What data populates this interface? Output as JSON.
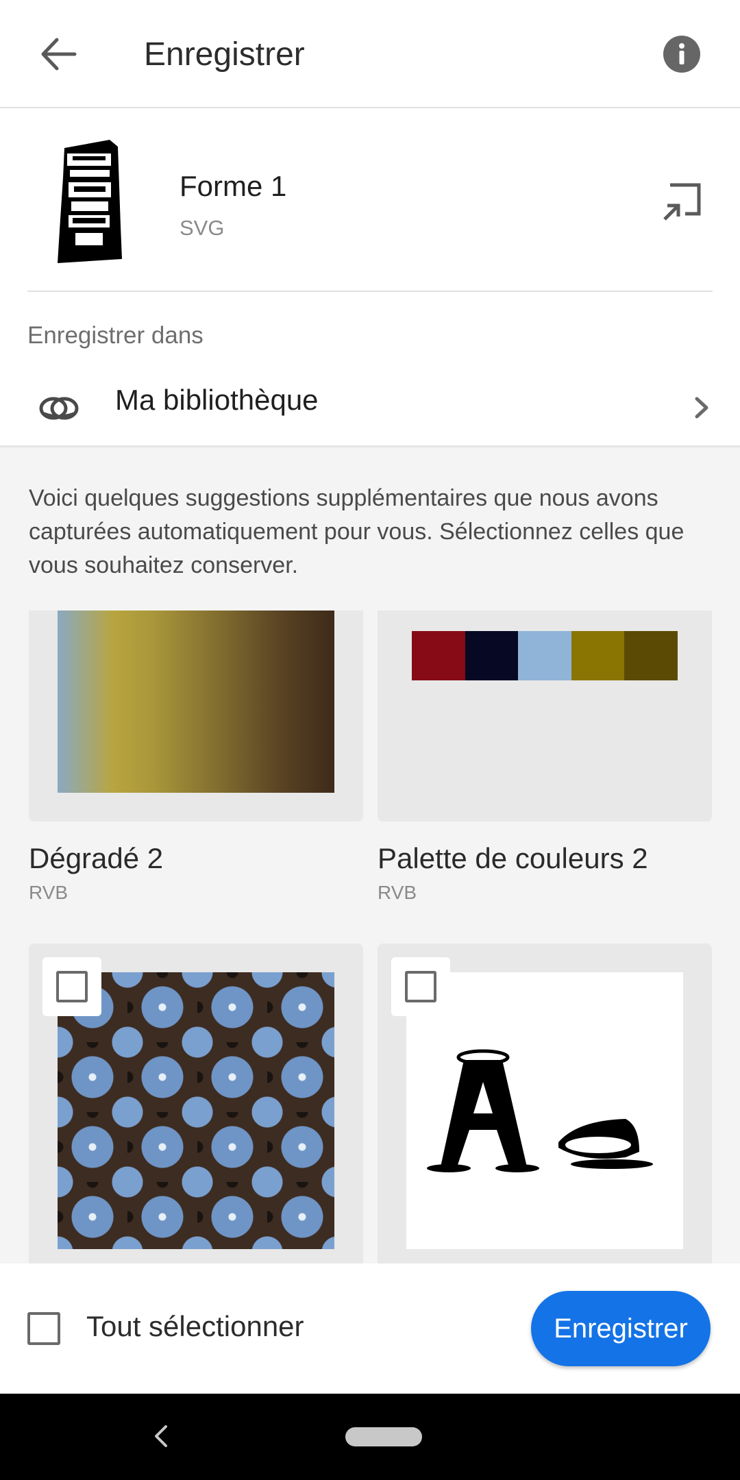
{
  "app_bar": {
    "title": "Enregistrer",
    "back_icon": "arrow-left-icon",
    "info_icon": "info-circle-icon"
  },
  "asset": {
    "name": "Forme 1",
    "type": "SVG",
    "thumbnail_icon": "shape-thumbnail",
    "open_icon": "open-in-icon"
  },
  "save_in": {
    "label": "Enregistrer dans",
    "library_name": "Ma bibliothèque",
    "library_icon": "creative-cloud-icon",
    "chevron_icon": "chevron-right-icon"
  },
  "suggestions": {
    "intro": "Voici quelques suggestions supplémentaires que nous avons capturées automatiquement pour vous. Sélectionnez celles que vous souhaitez conserver.",
    "items": [
      {
        "title": "Dégradé 2",
        "subtitle": "RVB",
        "kind": "gradient"
      },
      {
        "title": "Palette de couleurs 2",
        "subtitle": "RVB",
        "kind": "palette",
        "colors": [
          "#860b16",
          "#070924",
          "#8fb4d8",
          "#8a7502",
          "#5b4a04"
        ]
      },
      {
        "kind": "pattern",
        "checked": false
      },
      {
        "kind": "character-style",
        "checked": false
      }
    ]
  },
  "bottom_bar": {
    "select_all_label": "Tout sélectionner",
    "select_all_checked": false,
    "save_label": "Enregistrer",
    "accent_color": "#1473e6"
  },
  "system_nav": {
    "back_icon": "nav-back-icon",
    "home_icon": "nav-home-pill"
  }
}
